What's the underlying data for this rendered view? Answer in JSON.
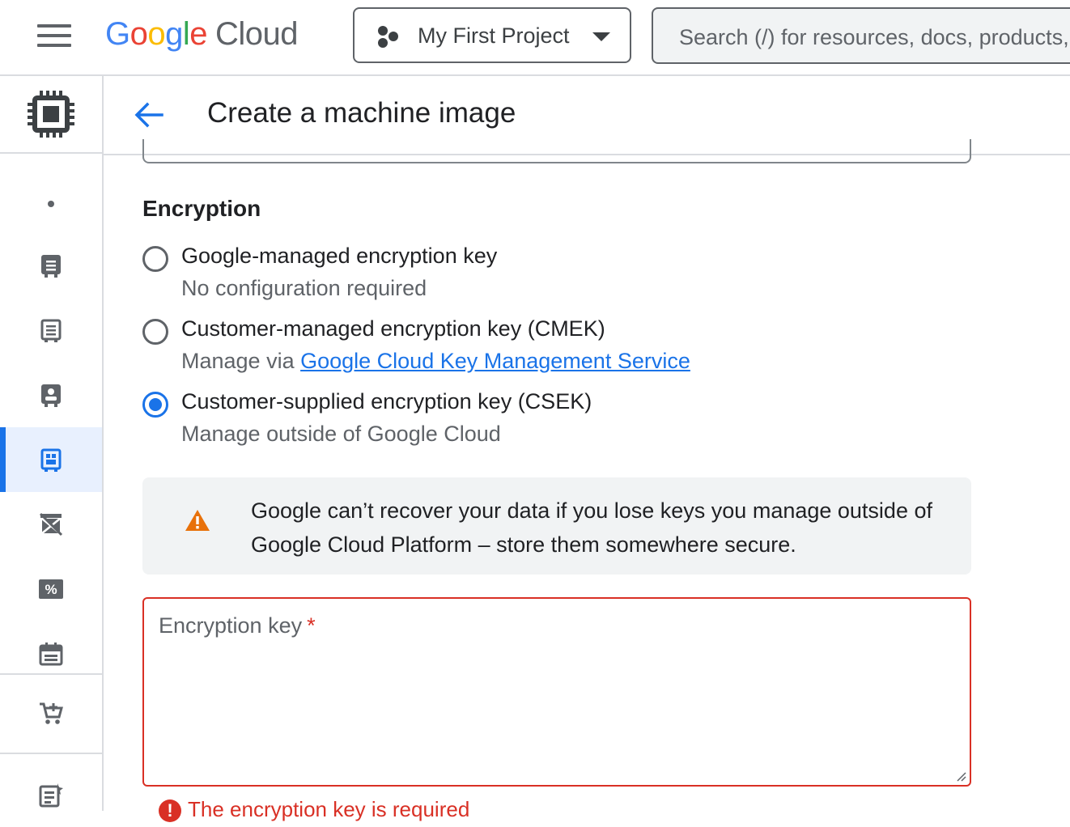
{
  "topbar": {
    "logo_google": [
      "G",
      "o",
      "o",
      "g",
      "l",
      "e"
    ],
    "logo_cloud": "Cloud",
    "project_label": "My First Project",
    "search_placeholder": "Search (/) for resources, docs, products, and more"
  },
  "rail": {
    "head_icon": "compute-chip-icon",
    "items": [
      {
        "icon": "dot-icon"
      },
      {
        "icon": "instance-icon"
      },
      {
        "icon": "template-icon"
      },
      {
        "icon": "sole-tenant-icon"
      },
      {
        "icon": "machine-image-icon",
        "active": true
      },
      {
        "icon": "tpu-icon"
      },
      {
        "icon": "discount-icon"
      },
      {
        "icon": "calendar-icon"
      },
      {
        "icon": "marketplace-cart-icon"
      },
      {
        "icon": "release-notes-icon"
      }
    ]
  },
  "page": {
    "title": "Create a machine image"
  },
  "encryption": {
    "title": "Encryption",
    "options": [
      {
        "label": "Google-managed encryption key",
        "sub": "No configuration required",
        "checked": false
      },
      {
        "label": "Customer-managed encryption key (CMEK)",
        "sub_prefix": "Manage via ",
        "sub_link": "Google Cloud Key Management Service",
        "checked": false
      },
      {
        "label": "Customer-supplied encryption key (CSEK)",
        "sub": "Manage outside of Google Cloud",
        "checked": true
      }
    ],
    "warning": "Google can’t recover your data if you lose keys you manage outside of Google Cloud Platform – store them somewhere secure.",
    "key_field": {
      "label": "Encryption key",
      "required_mark": "*",
      "value": ""
    },
    "error": "The encryption key is required"
  },
  "colors": {
    "accent": "#1a73e8",
    "error": "#d93025",
    "warning": "#e8710a"
  }
}
